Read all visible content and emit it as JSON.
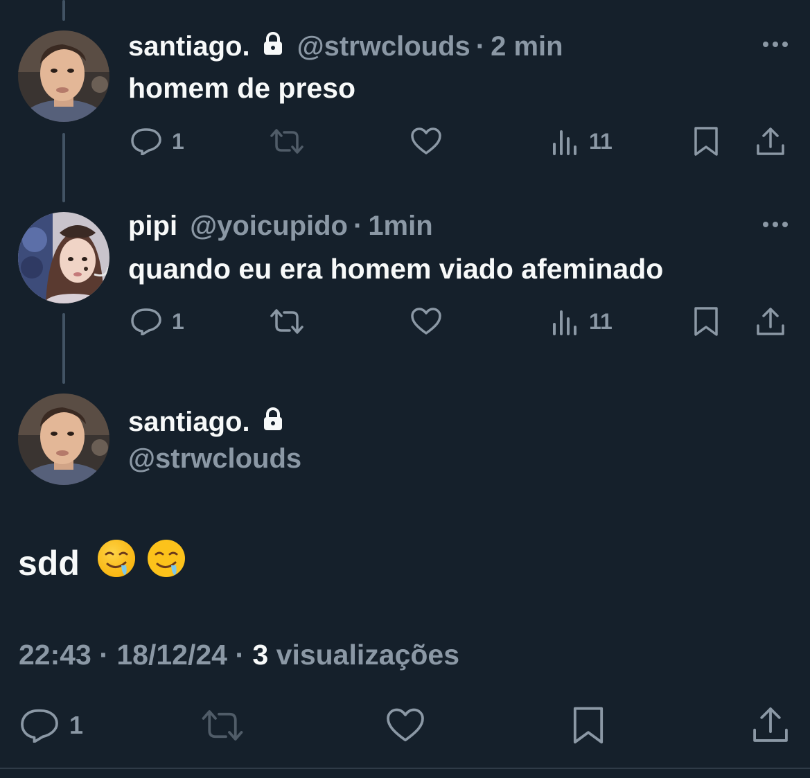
{
  "tweets": [
    {
      "display_name": "santiago.",
      "handle": "@strwclouds",
      "separator": "·",
      "time": "2 min",
      "text": "homem de preso",
      "replies": "1",
      "views": "11",
      "locked": true,
      "icons": [
        "reply-icon",
        "retweet-icon",
        "like-icon",
        "views-icon",
        "bookmark-icon",
        "share-icon"
      ]
    },
    {
      "display_name": "pipi",
      "handle": "@yoicupido",
      "separator": "·",
      "time": "1min",
      "text": "quando eu era homem viado afeminado",
      "replies": "1",
      "views": "11",
      "locked": false
    }
  ],
  "main_tweet": {
    "display_name": "santiago.",
    "handle": "@strwclouds",
    "text": "sdd",
    "emojis": [
      "drooling-face-emoji",
      "drooling-face-emoji"
    ],
    "time": "22:43",
    "date": "18/12/24",
    "separator": "·",
    "views_count": "3",
    "views_label": "visualizações",
    "replies": "1"
  },
  "colors": {
    "background": "#15202b",
    "text": "#f7f9f9",
    "muted": "#8b98a5",
    "thread_line": "#425364"
  }
}
